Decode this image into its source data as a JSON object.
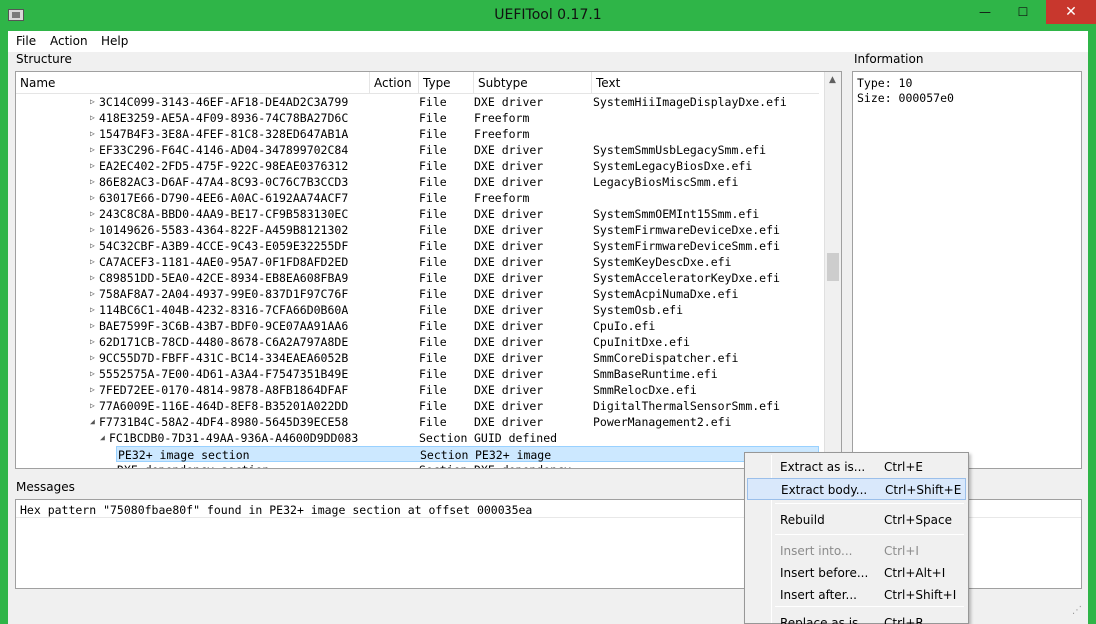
{
  "window": {
    "title": "UEFITool 0.17.1",
    "close_glyph": "✕",
    "min_glyph": "—",
    "max_glyph": "☐"
  },
  "menubar": [
    "File",
    "Action",
    "Help"
  ],
  "structure": {
    "label": "Structure",
    "columns": [
      "Name",
      "Action",
      "Type",
      "Subtype",
      "Text"
    ],
    "rows": [
      {
        "name": "3C14C099-3143-46EF-AF18-DE4AD2C3A799",
        "type": "File",
        "subtype": "DXE driver",
        "text": "SystemHiiImageDisplayDxe.efi",
        "expander": "▷"
      },
      {
        "name": "418E3259-AE5A-4F09-8936-74C78BA27D6C",
        "type": "File",
        "subtype": "Freeform",
        "text": "",
        "expander": "▷"
      },
      {
        "name": "1547B4F3-3E8A-4FEF-81C8-328ED647AB1A",
        "type": "File",
        "subtype": "Freeform",
        "text": "",
        "expander": "▷"
      },
      {
        "name": "EF33C296-F64C-4146-AD04-347899702C84",
        "type": "File",
        "subtype": "DXE driver",
        "text": "SystemSmmUsbLegacySmm.efi",
        "expander": "▷"
      },
      {
        "name": "EA2EC402-2FD5-475F-922C-98EAE0376312",
        "type": "File",
        "subtype": "DXE driver",
        "text": "SystemLegacyBiosDxe.efi",
        "expander": "▷"
      },
      {
        "name": "86E82AC3-D6AF-47A4-8C93-0C76C7B3CCD3",
        "type": "File",
        "subtype": "DXE driver",
        "text": "LegacyBiosMiscSmm.efi",
        "expander": "▷"
      },
      {
        "name": "63017E66-D790-4EE6-A0AC-6192AA74ACF7",
        "type": "File",
        "subtype": "Freeform",
        "text": "",
        "expander": "▷"
      },
      {
        "name": "243C8C8A-BBD0-4AA9-BE17-CF9B583130EC",
        "type": "File",
        "subtype": "DXE driver",
        "text": "SystemSmmOEMInt15Smm.efi",
        "expander": "▷"
      },
      {
        "name": "10149626-5583-4364-822F-A459B8121302",
        "type": "File",
        "subtype": "DXE driver",
        "text": "SystemFirmwareDeviceDxe.efi",
        "expander": "▷"
      },
      {
        "name": "54C32CBF-A3B9-4CCE-9C43-E059E32255DF",
        "type": "File",
        "subtype": "DXE driver",
        "text": "SystemFirmwareDeviceSmm.efi",
        "expander": "▷"
      },
      {
        "name": "CA7ACEF3-1181-4AE0-95A7-0F1FD8AFD2ED",
        "type": "File",
        "subtype": "DXE driver",
        "text": "SystemKeyDescDxe.efi",
        "expander": "▷"
      },
      {
        "name": "C89851DD-5EA0-42CE-8934-EB8EA608FBA9",
        "type": "File",
        "subtype": "DXE driver",
        "text": "SystemAcceleratorKeyDxe.efi",
        "expander": "▷"
      },
      {
        "name": "758AF8A7-2A04-4937-99E0-837D1F97C76F",
        "type": "File",
        "subtype": "DXE driver",
        "text": "SystemAcpiNumaDxe.efi",
        "expander": "▷"
      },
      {
        "name": "114BC6C1-404B-4232-8316-7CFA66D0B60A",
        "type": "File",
        "subtype": "DXE driver",
        "text": "SystemOsb.efi",
        "expander": "▷"
      },
      {
        "name": "BAE7599F-3C6B-43B7-BDF0-9CE07AA91AA6",
        "type": "File",
        "subtype": "DXE driver",
        "text": "CpuIo.efi",
        "expander": "▷"
      },
      {
        "name": "62D171CB-78CD-4480-8678-C6A2A797A8DE",
        "type": "File",
        "subtype": "DXE driver",
        "text": "CpuInitDxe.efi",
        "expander": "▷"
      },
      {
        "name": "9CC55D7D-FBFF-431C-BC14-334EAEA6052B",
        "type": "File",
        "subtype": "DXE driver",
        "text": "SmmCoreDispatcher.efi",
        "expander": "▷"
      },
      {
        "name": "5552575A-7E00-4D61-A3A4-F7547351B49E",
        "type": "File",
        "subtype": "DXE driver",
        "text": "SmmBaseRuntime.efi",
        "expander": "▷"
      },
      {
        "name": "7FED72EE-0170-4814-9878-A8FB1864DFAF",
        "type": "File",
        "subtype": "DXE driver",
        "text": "SmmRelocDxe.efi",
        "expander": "▷"
      },
      {
        "name": "77A6009E-116E-464D-8EF8-B35201A022DD",
        "type": "File",
        "subtype": "DXE driver",
        "text": "DigitalThermalSensorSmm.efi",
        "expander": "▷"
      },
      {
        "name": "F7731B4C-58A2-4DF4-8980-5645D39ECE58",
        "type": "File",
        "subtype": "DXE driver",
        "text": "PowerManagement2.efi",
        "expander": "◢"
      },
      {
        "name": "FC1BCDB0-7D31-49AA-936A-A4600D9DD083",
        "type": "Section",
        "subtype": "GUID defined",
        "text": "",
        "expander": "◢"
      },
      {
        "name": "PE32+ image section",
        "type": "Section",
        "subtype": "PE32+ image",
        "text": "",
        "expander": ""
      },
      {
        "name": "DXE dependency section",
        "type": "Section",
        "subtype": "DXE dependency",
        "text": "",
        "expander": ""
      }
    ],
    "scroll_up_glyph": "▲"
  },
  "information": {
    "label": "Information",
    "lines": [
      "Type: 10",
      "Size: 000057e0"
    ]
  },
  "messages": {
    "label": "Messages",
    "items": [
      "Hex pattern \"75080fbae80f\" found in PE32+ image section at offset 000035ea"
    ]
  },
  "status": {
    "grip_glyph": "⋰"
  },
  "context_menu": {
    "items": [
      {
        "label": "Extract as is...",
        "shortcut": "Ctrl+E",
        "disabled": false,
        "highlighted": false
      },
      {
        "label": "Extract body...",
        "shortcut": "Ctrl+Shift+E",
        "disabled": false,
        "highlighted": true
      },
      {
        "label": "Rebuild",
        "shortcut": "Ctrl+Space",
        "disabled": false,
        "highlighted": false
      },
      {
        "label": "Insert into...",
        "shortcut": "Ctrl+I",
        "disabled": true,
        "highlighted": false
      },
      {
        "label": "Insert before...",
        "shortcut": "Ctrl+Alt+I",
        "disabled": false,
        "highlighted": false
      },
      {
        "label": "Insert after...",
        "shortcut": "Ctrl+Shift+I",
        "disabled": false,
        "highlighted": false
      },
      {
        "label": "Replace as is...",
        "shortcut": "Ctrl+R",
        "disabled": false,
        "highlighted": false
      }
    ]
  }
}
